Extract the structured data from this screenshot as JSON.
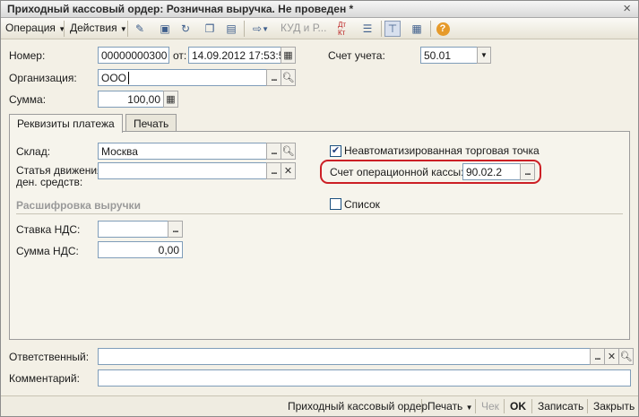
{
  "window": {
    "title": "Приходный кассовый ордер: Розничная выручка. Не проведен *"
  },
  "toolbar": {
    "operation_label": "Операция",
    "actions_label": "Действия",
    "kud_label": "КУД и Р...",
    "dtkt_label": "Дт Кт"
  },
  "header": {
    "number_label": "Номер:",
    "number_value": "00000000300",
    "date_label": "от:",
    "date_value": "14.09.2012 17:53:56",
    "account_label": "Счет учета:",
    "account_value": "50.01",
    "org_label": "Организация:",
    "org_value": "ООО",
    "sum_label": "Сумма:",
    "sum_value": "100,00"
  },
  "tabs": [
    {
      "label": "Реквизиты платежа"
    },
    {
      "label": "Печать"
    }
  ],
  "payment": {
    "warehouse_label": "Склад:",
    "warehouse_value": "Москва",
    "cashflow_label_line1": "Статья движения",
    "cashflow_label_line2": "ден. средств:",
    "cashflow_value": "",
    "nonauto_label": "Неавтоматизированная торговая точка",
    "nonauto_checked": true,
    "op_account_label": "Счет операционной кассы:",
    "op_account_value": "90.02.2",
    "revenue_section": "Расшифровка выручки",
    "list_label": "Список",
    "list_checked": false,
    "vat_rate_label": "Ставка НДС:",
    "vat_rate_value": "",
    "vat_sum_label": "Сумма НДС:",
    "vat_sum_value": "0,00"
  },
  "footer_fields": {
    "responsible_label": "Ответственный:",
    "responsible_value": "",
    "comment_label": "Комментарий:",
    "comment_value": ""
  },
  "bottombar": {
    "print_form_label": "Приходный кассовый ордер",
    "print_label": "Печать",
    "check_label": "Чек",
    "ok_label": "OK",
    "save_label": "Записать",
    "close_label": "Закрыть"
  },
  "colors": {
    "highlight": "#cc1f25",
    "field_border": "#7f9db9"
  }
}
